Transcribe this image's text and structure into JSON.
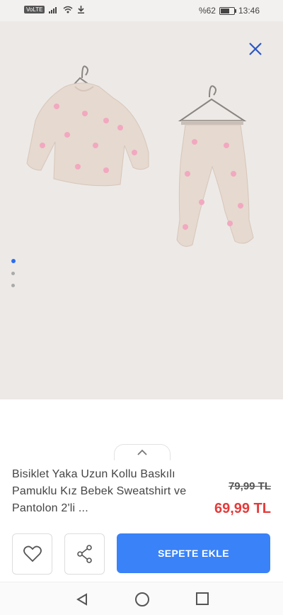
{
  "status_bar": {
    "volte": "VoLTE",
    "battery_text": "%62",
    "time": "13:46",
    "battery_level": 0.62
  },
  "gallery": {
    "image_index": 1,
    "image_count": 3
  },
  "product": {
    "title": "Bisiklet Yaka Uzun Kollu Baskılı Pamuklu Kız Bebek Sweatshirt ve Pantolon 2'li ...",
    "old_price": "79,99 TL",
    "price": "69,99 TL"
  },
  "actions": {
    "add_to_cart": "SEPETE EKLE"
  },
  "icons": {
    "close": "close-icon",
    "favorite": "heart-icon",
    "share": "share-icon",
    "collapse": "chevron-up-icon"
  },
  "colors": {
    "accent": "#3a82f7",
    "price": "#e53b3b",
    "background": "#ede9e6"
  }
}
